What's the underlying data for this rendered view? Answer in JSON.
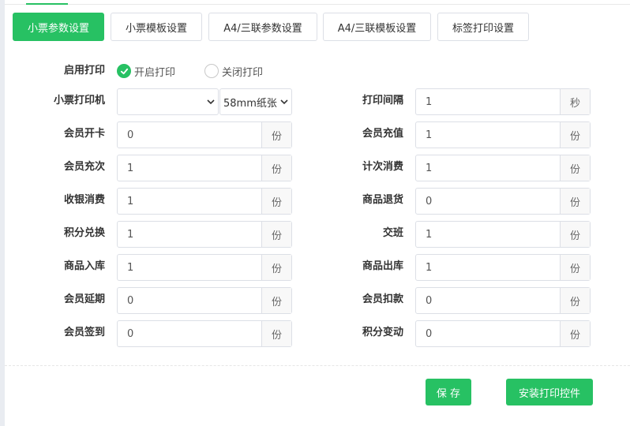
{
  "tabs": [
    {
      "label": "小票参数设置",
      "active": true
    },
    {
      "label": "小票模板设置",
      "active": false
    },
    {
      "label": "A4/三联参数设置",
      "active": false
    },
    {
      "label": "A4/三联模板设置",
      "active": false
    },
    {
      "label": "标签打印设置",
      "active": false
    }
  ],
  "print_enable": {
    "label": "启用打印",
    "on_label": "开启打印",
    "off_label": "关闭打印",
    "selected": "on"
  },
  "printer": {
    "label": "小票打印机",
    "printer_value": "",
    "paper_value": "58mm纸张"
  },
  "interval": {
    "label": "打印间隔",
    "value": "1",
    "unit": "秒"
  },
  "unit": "份",
  "fields_left": [
    {
      "label": "会员开卡",
      "value": "0"
    },
    {
      "label": "会员充次",
      "value": "1"
    },
    {
      "label": "收银消费",
      "value": "1"
    },
    {
      "label": "积分兑换",
      "value": "1"
    },
    {
      "label": "商品入库",
      "value": "1"
    },
    {
      "label": "会员延期",
      "value": "0"
    },
    {
      "label": "会员签到",
      "value": "0"
    }
  ],
  "fields_right": [
    {
      "label": "会员充值",
      "value": "1"
    },
    {
      "label": "计次消费",
      "value": "1"
    },
    {
      "label": "商品退货",
      "value": "0"
    },
    {
      "label": "交班",
      "value": "1"
    },
    {
      "label": "商品出库",
      "value": "1"
    },
    {
      "label": "会员扣款",
      "value": "0"
    },
    {
      "label": "积分变动",
      "value": "0"
    }
  ],
  "actions": {
    "save_label": "保 存",
    "install_label": "安装打印控件"
  },
  "colors": {
    "accent": "#27c163"
  }
}
